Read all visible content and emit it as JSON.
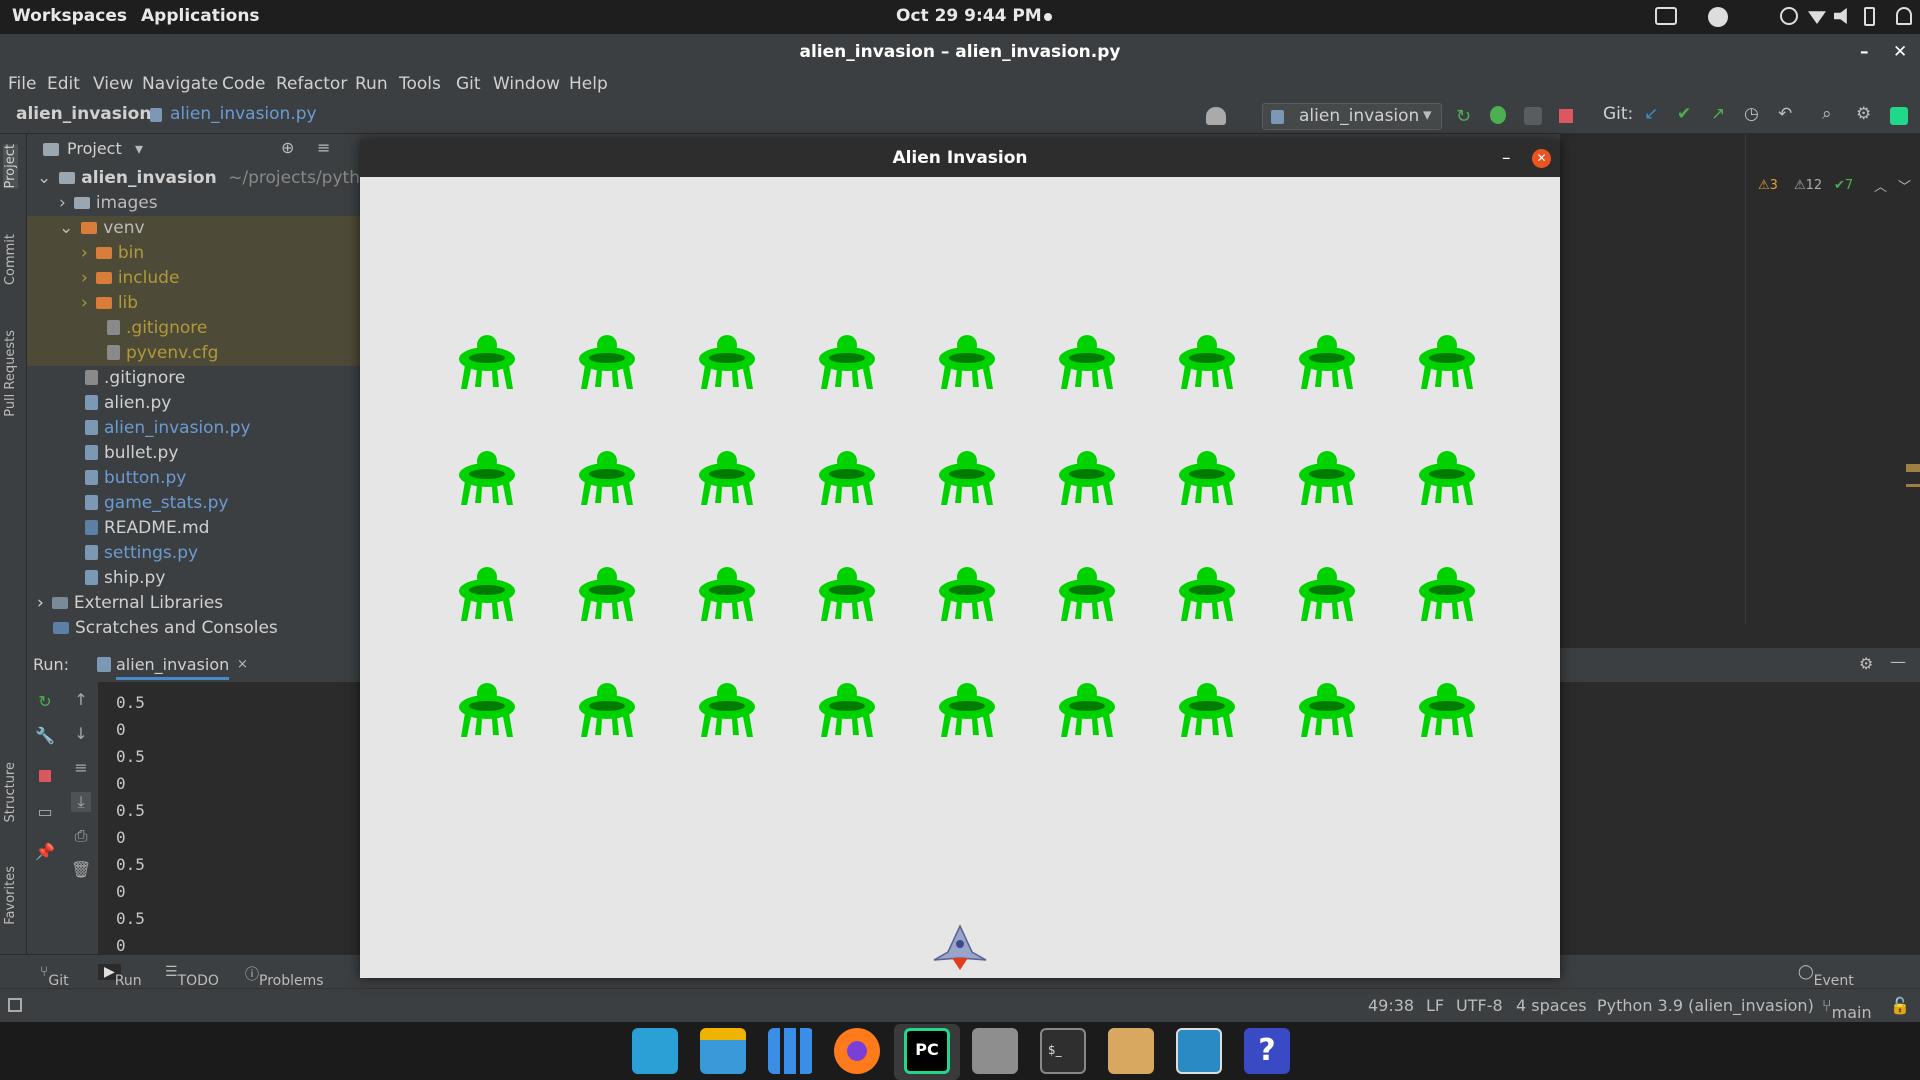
{
  "system_bar": {
    "workspaces": "Workspaces",
    "applications": "Applications",
    "clock": "Oct 29  9:44 PM"
  },
  "ide": {
    "window_title": "alien_invasion – alien_invasion.py",
    "menu": [
      "File",
      "Edit",
      "View",
      "Navigate",
      "Code",
      "Refactor",
      "Run",
      "Tools",
      "Git",
      "Window",
      "Help"
    ],
    "breadcrumb_project": "alien_invasion",
    "breadcrumb_file": "alien_invasion.py",
    "run_config": "alien_invasion",
    "git_label": "Git:",
    "inspections": {
      "warnings": "3",
      "weak_warnings": "12",
      "ok": "7"
    }
  },
  "left_strip": {
    "project": "Project",
    "commit": "Commit",
    "pull_requests": "Pull Requests",
    "structure": "Structure",
    "favorites": "Favorites"
  },
  "project_panel": {
    "title": "Project",
    "root": "alien_invasion",
    "root_path": "~/projects/python_c",
    "items": [
      {
        "label": "images",
        "type": "folder",
        "depth": 1,
        "expanded": false
      },
      {
        "label": "venv",
        "type": "folder-orange",
        "depth": 1,
        "expanded": true
      },
      {
        "label": "bin",
        "type": "folder-orange",
        "depth": 2,
        "expanded": false
      },
      {
        "label": "include",
        "type": "folder-orange",
        "depth": 2,
        "expanded": false
      },
      {
        "label": "lib",
        "type": "folder-orange",
        "depth": 2,
        "expanded": false
      },
      {
        "label": ".gitignore",
        "type": "file-venv",
        "depth": 3
      },
      {
        "label": "pyvenv.cfg",
        "type": "file-venv",
        "depth": 3
      },
      {
        "label": ".gitignore",
        "type": "file",
        "depth": 2
      },
      {
        "label": "alien.py",
        "type": "py",
        "depth": 2
      },
      {
        "label": "alien_invasion.py",
        "type": "py-mod",
        "depth": 2
      },
      {
        "label": "bullet.py",
        "type": "py",
        "depth": 2
      },
      {
        "label": "button.py",
        "type": "py-mod",
        "depth": 2
      },
      {
        "label": "game_stats.py",
        "type": "py-mod",
        "depth": 2
      },
      {
        "label": "README.md",
        "type": "md",
        "depth": 2
      },
      {
        "label": "settings.py",
        "type": "py-mod",
        "depth": 2
      },
      {
        "label": "ship.py",
        "type": "py",
        "depth": 2
      }
    ],
    "external_libraries": "External Libraries",
    "scratches": "Scratches and Consoles"
  },
  "run_panel": {
    "label": "Run:",
    "tab": "alien_invasion",
    "output": [
      "0.5",
      "0",
      "0.5",
      "0",
      "0.5",
      "0",
      "0.5",
      "0",
      "0.5",
      "0"
    ]
  },
  "bottom_tabs": {
    "git": "Git",
    "run": "Run",
    "todo": "TODO",
    "problems": "Problems",
    "event_log": "Event Log"
  },
  "status_bar": {
    "position": "49:38",
    "line_sep": "LF",
    "encoding": "UTF-8",
    "indent": "4 spaces",
    "interpreter": "Python 3.9 (alien_invasion)",
    "branch": "main"
  },
  "game": {
    "title": "Alien Invasion",
    "alien_rows": 4,
    "alien_cols": 9,
    "alien_color": "#00d200"
  },
  "colors": {
    "ide_bg": "#2b2b2b",
    "panel_bg": "#3c3f41",
    "game_bg": "#e6e6e6",
    "close_button": "#e95420",
    "alien_green": "#00d200"
  }
}
